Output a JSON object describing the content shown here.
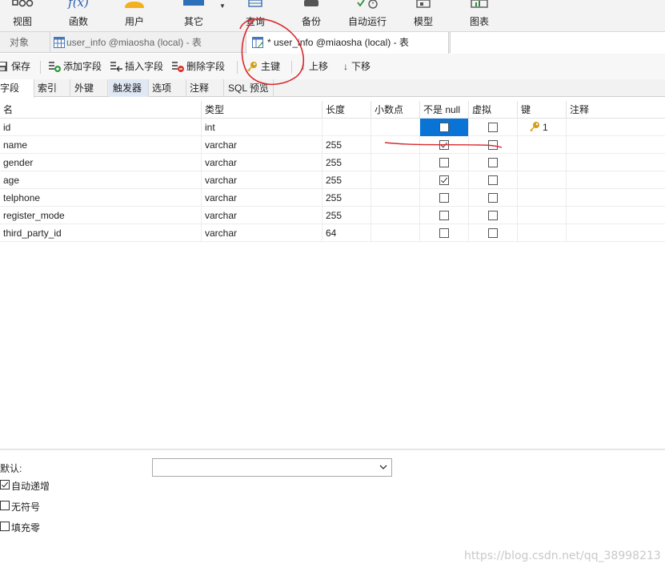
{
  "toolbar": {
    "items": [
      {
        "label": "视图",
        "icon": "view-icon"
      },
      {
        "label": "函数",
        "icon": "function-icon",
        "glyph": "f(x)"
      },
      {
        "label": "用户",
        "icon": "user-icon"
      },
      {
        "label": "其它",
        "icon": "other-icon"
      },
      {
        "label": "查询",
        "icon": "query-icon"
      },
      {
        "label": "备份",
        "icon": "backup-icon"
      },
      {
        "label": "自动运行",
        "icon": "autorun-icon"
      },
      {
        "label": "模型",
        "icon": "model-icon"
      },
      {
        "label": "图表",
        "icon": "chart-icon"
      }
    ]
  },
  "tabs": {
    "objects_label": "对象",
    "tab1": "user_info @miaosha (local) - 表",
    "tab2": "* user_info @miaosha (local) - 表"
  },
  "actions": {
    "save": "保存",
    "add_field": "添加字段",
    "insert_field": "插入字段",
    "delete_field": "删除字段",
    "primary_key": "主键",
    "move_up": "上移",
    "move_down": "下移"
  },
  "sub_tabs": [
    "字段",
    "索引",
    "外键",
    "触发器",
    "选项",
    "注释",
    "SQL 预览"
  ],
  "grid": {
    "headers": [
      "名",
      "类型",
      "长度",
      "小数点",
      "不是 null",
      "虚拟",
      "键",
      "注释"
    ],
    "rows": [
      {
        "name": "id",
        "type": "int",
        "length": "",
        "decimal": "",
        "not_null": false,
        "virtual": false,
        "key": "1"
      },
      {
        "name": "name",
        "type": "varchar",
        "length": "255",
        "decimal": "",
        "not_null": true,
        "virtual": false,
        "key": ""
      },
      {
        "name": "gender",
        "type": "varchar",
        "length": "255",
        "decimal": "",
        "not_null": false,
        "virtual": false,
        "key": ""
      },
      {
        "name": "age",
        "type": "varchar",
        "length": "255",
        "decimal": "",
        "not_null": true,
        "virtual": false,
        "key": ""
      },
      {
        "name": "telphone",
        "type": "varchar",
        "length": "255",
        "decimal": "",
        "not_null": false,
        "virtual": false,
        "key": ""
      },
      {
        "name": "register_mode",
        "type": "varchar",
        "length": "255",
        "decimal": "",
        "not_null": false,
        "virtual": false,
        "key": ""
      },
      {
        "name": "third_party_id",
        "type": "varchar",
        "length": "64",
        "decimal": "",
        "not_null": false,
        "virtual": false,
        "key": ""
      }
    ]
  },
  "properties": {
    "default_label": "默认:",
    "default_value": "",
    "auto_increment_label": "自动递增",
    "auto_increment": true,
    "unsigned_label": "无符号",
    "unsigned": false,
    "zerofill_label": "填充零",
    "zerofill": false
  },
  "watermark": "https://blog.csdn.net/qq_38998213",
  "colors": {
    "selection": "#0a74d6",
    "annotation": "#d9282e",
    "key_icon": "#d4a017"
  }
}
